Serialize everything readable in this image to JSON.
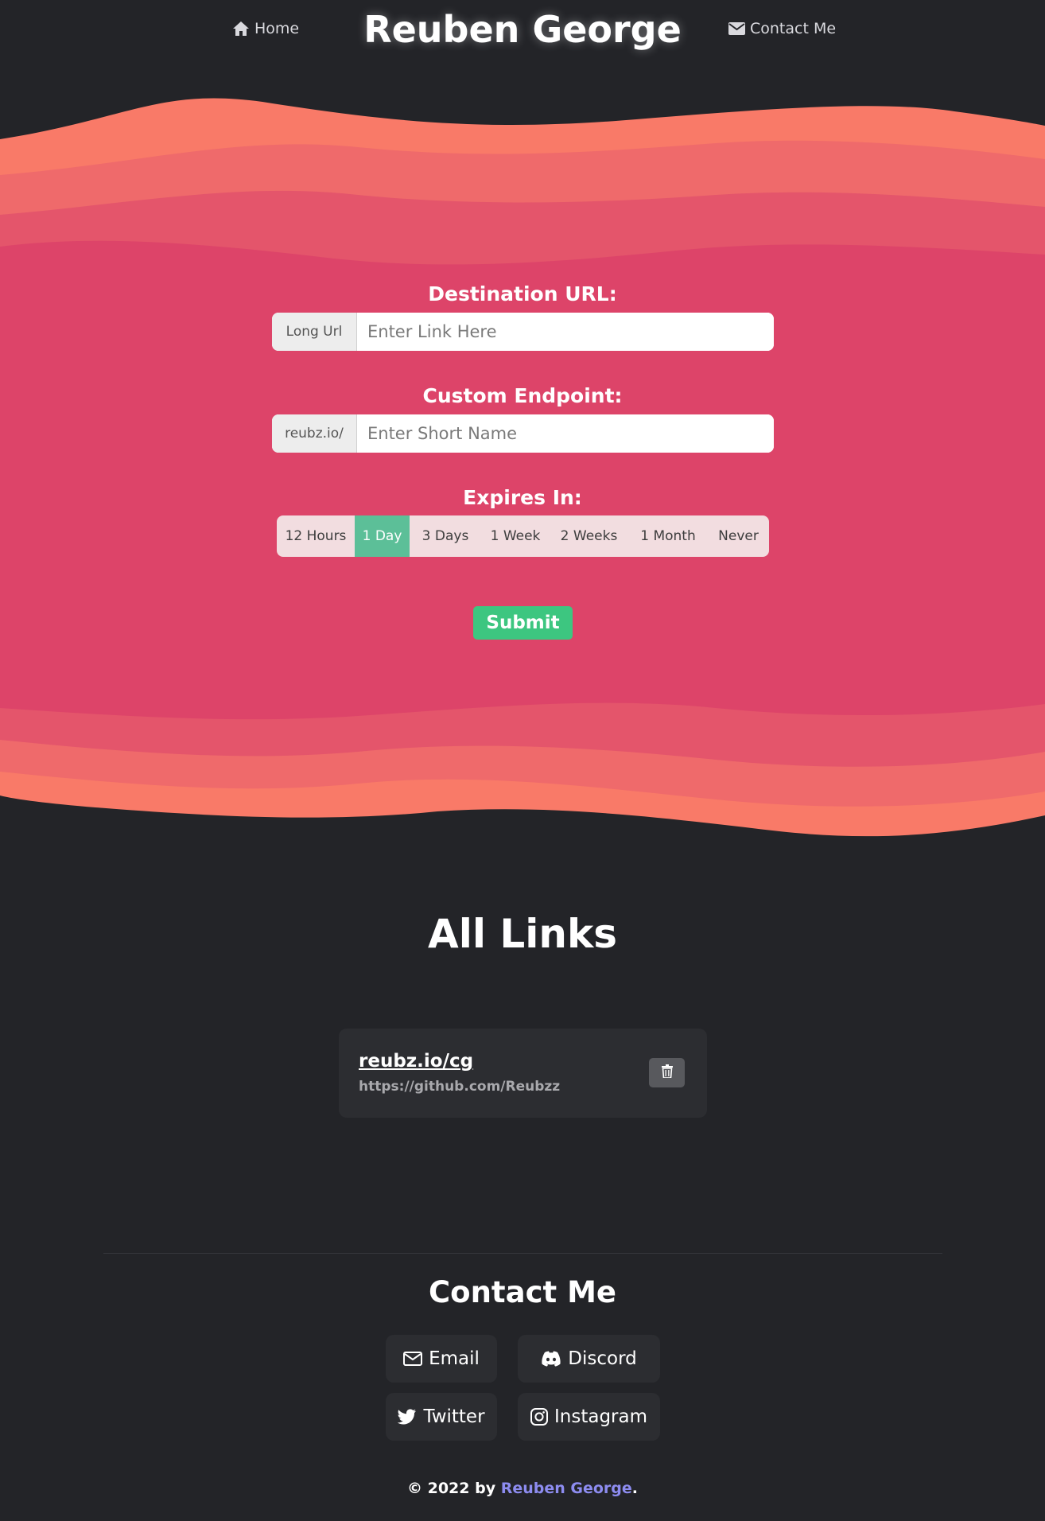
{
  "nav": {
    "home_label": "Home",
    "brand": "Reuben George",
    "contact_label": "Contact Me"
  },
  "form": {
    "destination": {
      "title": "Destination URL:",
      "prefix": "Long Url",
      "placeholder": "Enter Link Here",
      "value": ""
    },
    "endpoint": {
      "title": "Custom Endpoint:",
      "prefix": "reubz.io/",
      "placeholder": "Enter Short Name",
      "value": ""
    },
    "expiry": {
      "title": "Expires In:",
      "options": [
        "12 Hours",
        "1 Day",
        "3 Days",
        "1 Week",
        "2 Weeks",
        "1 Month",
        "Never"
      ],
      "selected": "1 Day"
    },
    "submit_label": "Submit"
  },
  "links": {
    "title": "All Links",
    "items": [
      {
        "short": "reubz.io/cg",
        "long": "https://github.com/Reubzz"
      }
    ]
  },
  "contact": {
    "title": "Contact Me",
    "buttons": {
      "email": "Email",
      "discord": "Discord",
      "twitter": "Twitter",
      "instagram": "Instagram"
    }
  },
  "footer": {
    "prefix": "© 2022 by ",
    "author": "Reuben George",
    "suffix": "."
  },
  "colors": {
    "background": "#232428",
    "wave_light": "#f97a68",
    "wave_mid": "#ef6a6b",
    "wave_main": "#dd4469",
    "accent_green": "#3dc680",
    "active_green": "#5cbf98",
    "footer_link": "#8d8cf0"
  }
}
